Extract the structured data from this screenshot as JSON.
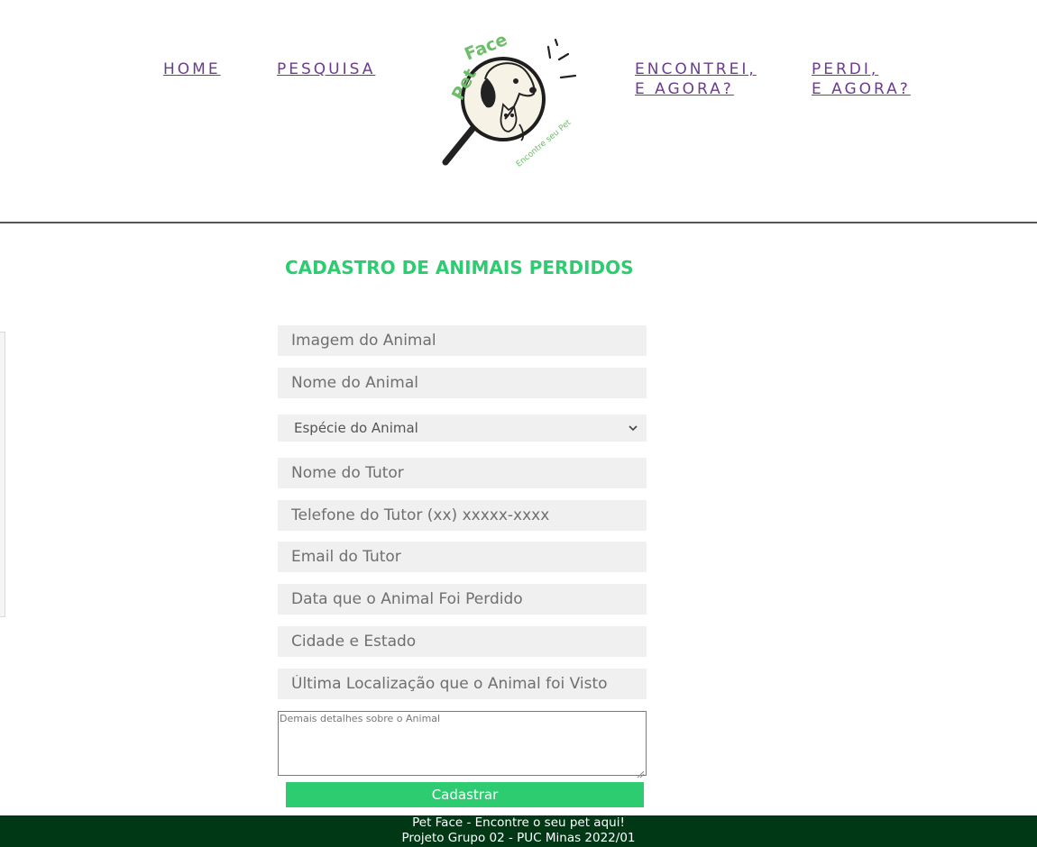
{
  "nav": {
    "home": "HOME",
    "pesquisa": "PESQUISA",
    "encontrei_line1": "ENCONTREI,",
    "encontrei_line2": "E AGORA?",
    "perdi_line1": "PERDI,",
    "perdi_line2": "E AGORA?"
  },
  "logo": {
    "brand_text": "Pet Face",
    "tagline": "Encontre seu Pet",
    "colors": {
      "green": "#6dbe6a",
      "cream": "#f6f3e6",
      "dark": "#222222"
    }
  },
  "form": {
    "title": "CADASTRO DE ANIMAIS PERDIDOS",
    "image_placeholder": "Imagem do Animal",
    "name_placeholder": "Nome do Animal",
    "species_selected": "Espécie do Animal",
    "tutor_name_placeholder": "Nome do Tutor",
    "tutor_phone_placeholder": "Telefone do Tutor (xx) xxxxx-xxxx",
    "tutor_email_placeholder": "Email do Tutor",
    "lost_date_placeholder": "Data que o Animal Foi Perdido",
    "city_state_placeholder": "Cidade e Estado",
    "last_location_placeholder": "Última Localização que o Animal foi Visto",
    "details_placeholder": "Demais detalhes sobre o Animal",
    "submit_label": "Cadastrar"
  },
  "footer": {
    "line1": "Pet Face - Encontre o seu pet aqui!",
    "line2": "Projeto Grupo 02 - PUC Minas 2022/01"
  },
  "colors": {
    "accent": "#2ecc71",
    "nav_link": "#6b3d8c",
    "footer_bg": "#003815",
    "field_bg": "#f0f0f0"
  }
}
